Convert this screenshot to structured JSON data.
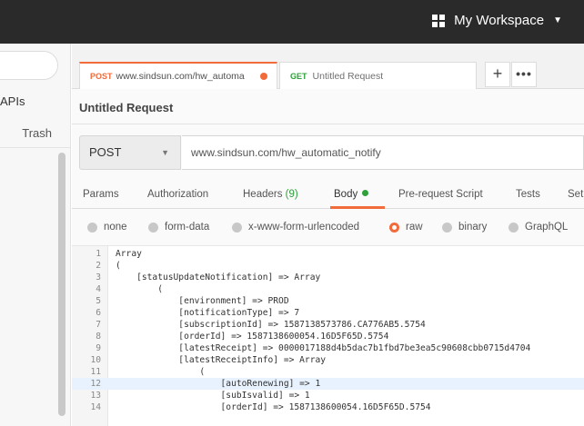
{
  "header": {
    "workspace_label": "My Workspace",
    "workspace_icon": "grid-icon"
  },
  "sidebar": {
    "apis_label": "APIs",
    "trash_label": "Trash"
  },
  "tabs": [
    {
      "method": "POST",
      "label": "www.sindsun.com/hw_automa"
    },
    {
      "method": "GET",
      "label": "Untitled Request"
    }
  ],
  "tab_actions": {
    "add": "+",
    "more": "•••"
  },
  "request": {
    "title": "Untitled Request",
    "method": "POST",
    "url": "www.sindsun.com/hw_automatic_notify"
  },
  "request_tabs": {
    "params": "Params",
    "authorization": "Authorization",
    "headers": "Headers",
    "headers_count": "(9)",
    "body": "Body",
    "prerequest": "Pre-request Script",
    "tests": "Tests",
    "settings": "Set"
  },
  "body_types": {
    "none": "none",
    "formdata": "form-data",
    "urlencoded": "x-www-form-urlencoded",
    "raw": "raw",
    "binary": "binary",
    "graphql": "GraphQL",
    "selected": "raw"
  },
  "editor": {
    "lines": [
      {
        "n": "1",
        "text": "Array"
      },
      {
        "n": "2",
        "text": "("
      },
      {
        "n": "3",
        "text": "    [statusUpdateNotification] => Array"
      },
      {
        "n": "4",
        "text": "        ("
      },
      {
        "n": "5",
        "text": "            [environment] => PROD"
      },
      {
        "n": "6",
        "text": "            [notificationType] => 7"
      },
      {
        "n": "7",
        "text": "            [subscriptionId] => 1587138573786.CA776AB5.5754"
      },
      {
        "n": "8",
        "text": "            [orderId] => 1587138600054.16D5F65D.5754"
      },
      {
        "n": "9",
        "text": "            [latestReceipt] => 0000017188d4b5dac7b1fbd7be3ea5c90608cbb0715d4704"
      },
      {
        "n": "10",
        "text": "            [latestReceiptInfo] => Array"
      },
      {
        "n": "11",
        "text": "                ("
      },
      {
        "n": "12",
        "text": "                    [autoRenewing] => 1"
      },
      {
        "n": "13",
        "text": "                    [subIsvalid] => 1"
      },
      {
        "n": "14",
        "text": "                    [orderId] => 1587138600054.16D5F65D.5754"
      }
    ],
    "highlighted_line": "12"
  },
  "colors": {
    "accent": "#f26b3a",
    "get_method": "#2fa03a",
    "topbar": "#2a2a2a"
  }
}
